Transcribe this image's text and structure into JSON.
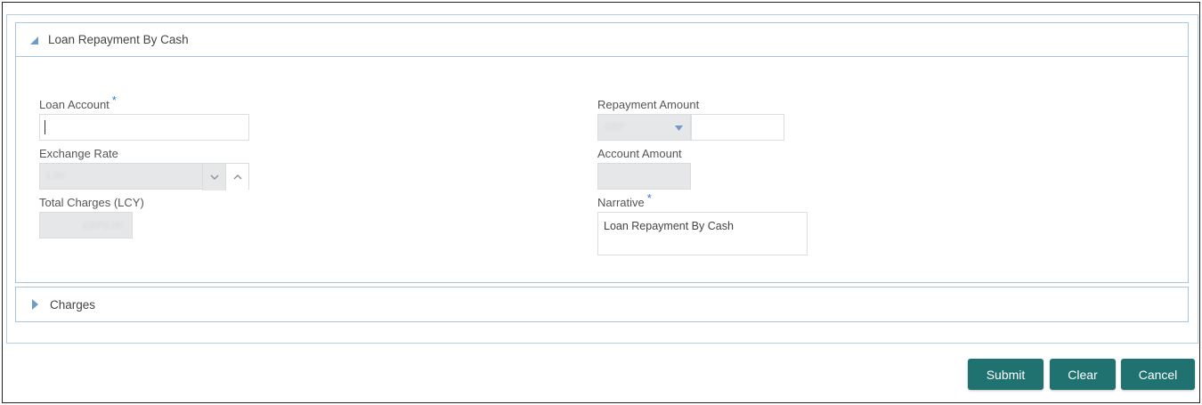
{
  "section": {
    "title": "Loan Repayment By Cash"
  },
  "fields": {
    "loan_account": {
      "label": "Loan Account",
      "required": "*",
      "value": ""
    },
    "exchange_rate": {
      "label": "Exchange Rate",
      "value": "1.00"
    },
    "total_charges": {
      "label": "Total Charges (LCY)",
      "value": "GBP0.00"
    },
    "repayment_amount": {
      "label": "Repayment Amount",
      "currency": "GBP",
      "value": ""
    },
    "account_amount": {
      "label": "Account Amount",
      "value": ""
    },
    "narrative": {
      "label": "Narrative",
      "required": "*",
      "value": "Loan Repayment By Cash"
    }
  },
  "charges": {
    "title": "Charges"
  },
  "buttons": {
    "submit": "Submit",
    "clear": "Clear",
    "cancel": "Cancel"
  },
  "colors": {
    "accent": "#1f7270",
    "panel_border": "#a9c4df",
    "required": "#2b7bd3"
  }
}
